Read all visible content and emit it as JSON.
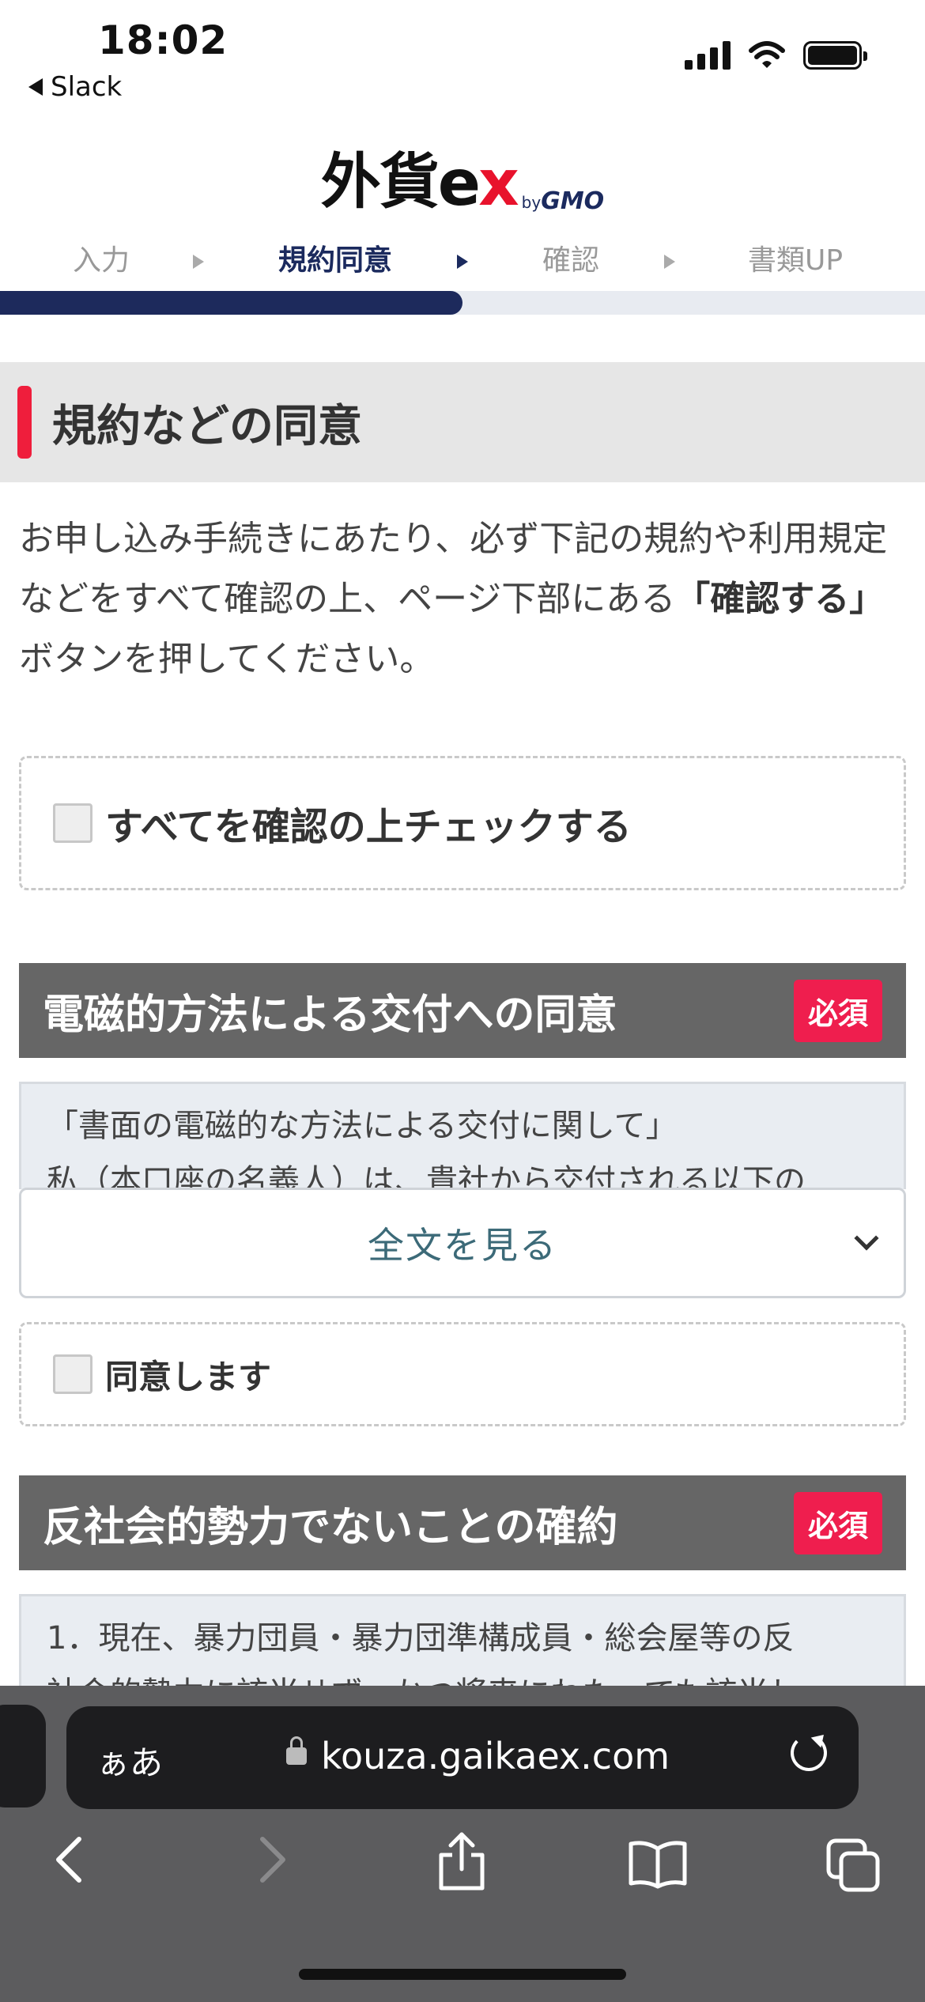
{
  "status_bar": {
    "time": "18:02",
    "back_app": "Slack"
  },
  "logo": {
    "main": "外貨",
    "ex_e": "e",
    "ex_x": "x",
    "by": "by",
    "gmo": "GMO"
  },
  "steps": [
    {
      "label": "入力",
      "active": false
    },
    {
      "label": "規約同意",
      "active": true
    },
    {
      "label": "確認",
      "active": false
    },
    {
      "label": "書類UP",
      "active": false
    }
  ],
  "progress_fraction": 0.5,
  "section": {
    "title": "規約などの同意",
    "intro_before": "お申し込み手続きにあたり、必ず下記の規約や利用規定などをすべて確認の上、ページ下部にある",
    "intro_bold": "「確認する」",
    "intro_after": "ボタンを押してください。"
  },
  "check_all_label": "すべてを確認の上チェックする",
  "agreements": [
    {
      "title": "電磁的方法による交付への同意",
      "badge": "必須",
      "text_line1": "「書面の電磁的な方法による交付に関して」",
      "text_line2": "私（本口座の名義人）は、貴社から交付される以下の",
      "fulltext_label": "全文を見る",
      "agree_label": "同意します"
    },
    {
      "title": "反社会的勢力でないことの確約",
      "badge": "必須",
      "text_line1": "1．現在、暴力団員・暴力団準構成員・総会屋等の反",
      "text_line2": "社会的勢力に該当せず、かつ将来にわたっても該当し"
    }
  ],
  "browser": {
    "aa_label": "ぁあ",
    "url": "kouza.gaikaex.com"
  },
  "colors": {
    "accent_red": "#ef1e3c",
    "navy": "#1d2a5c",
    "header_gray": "#666666"
  }
}
